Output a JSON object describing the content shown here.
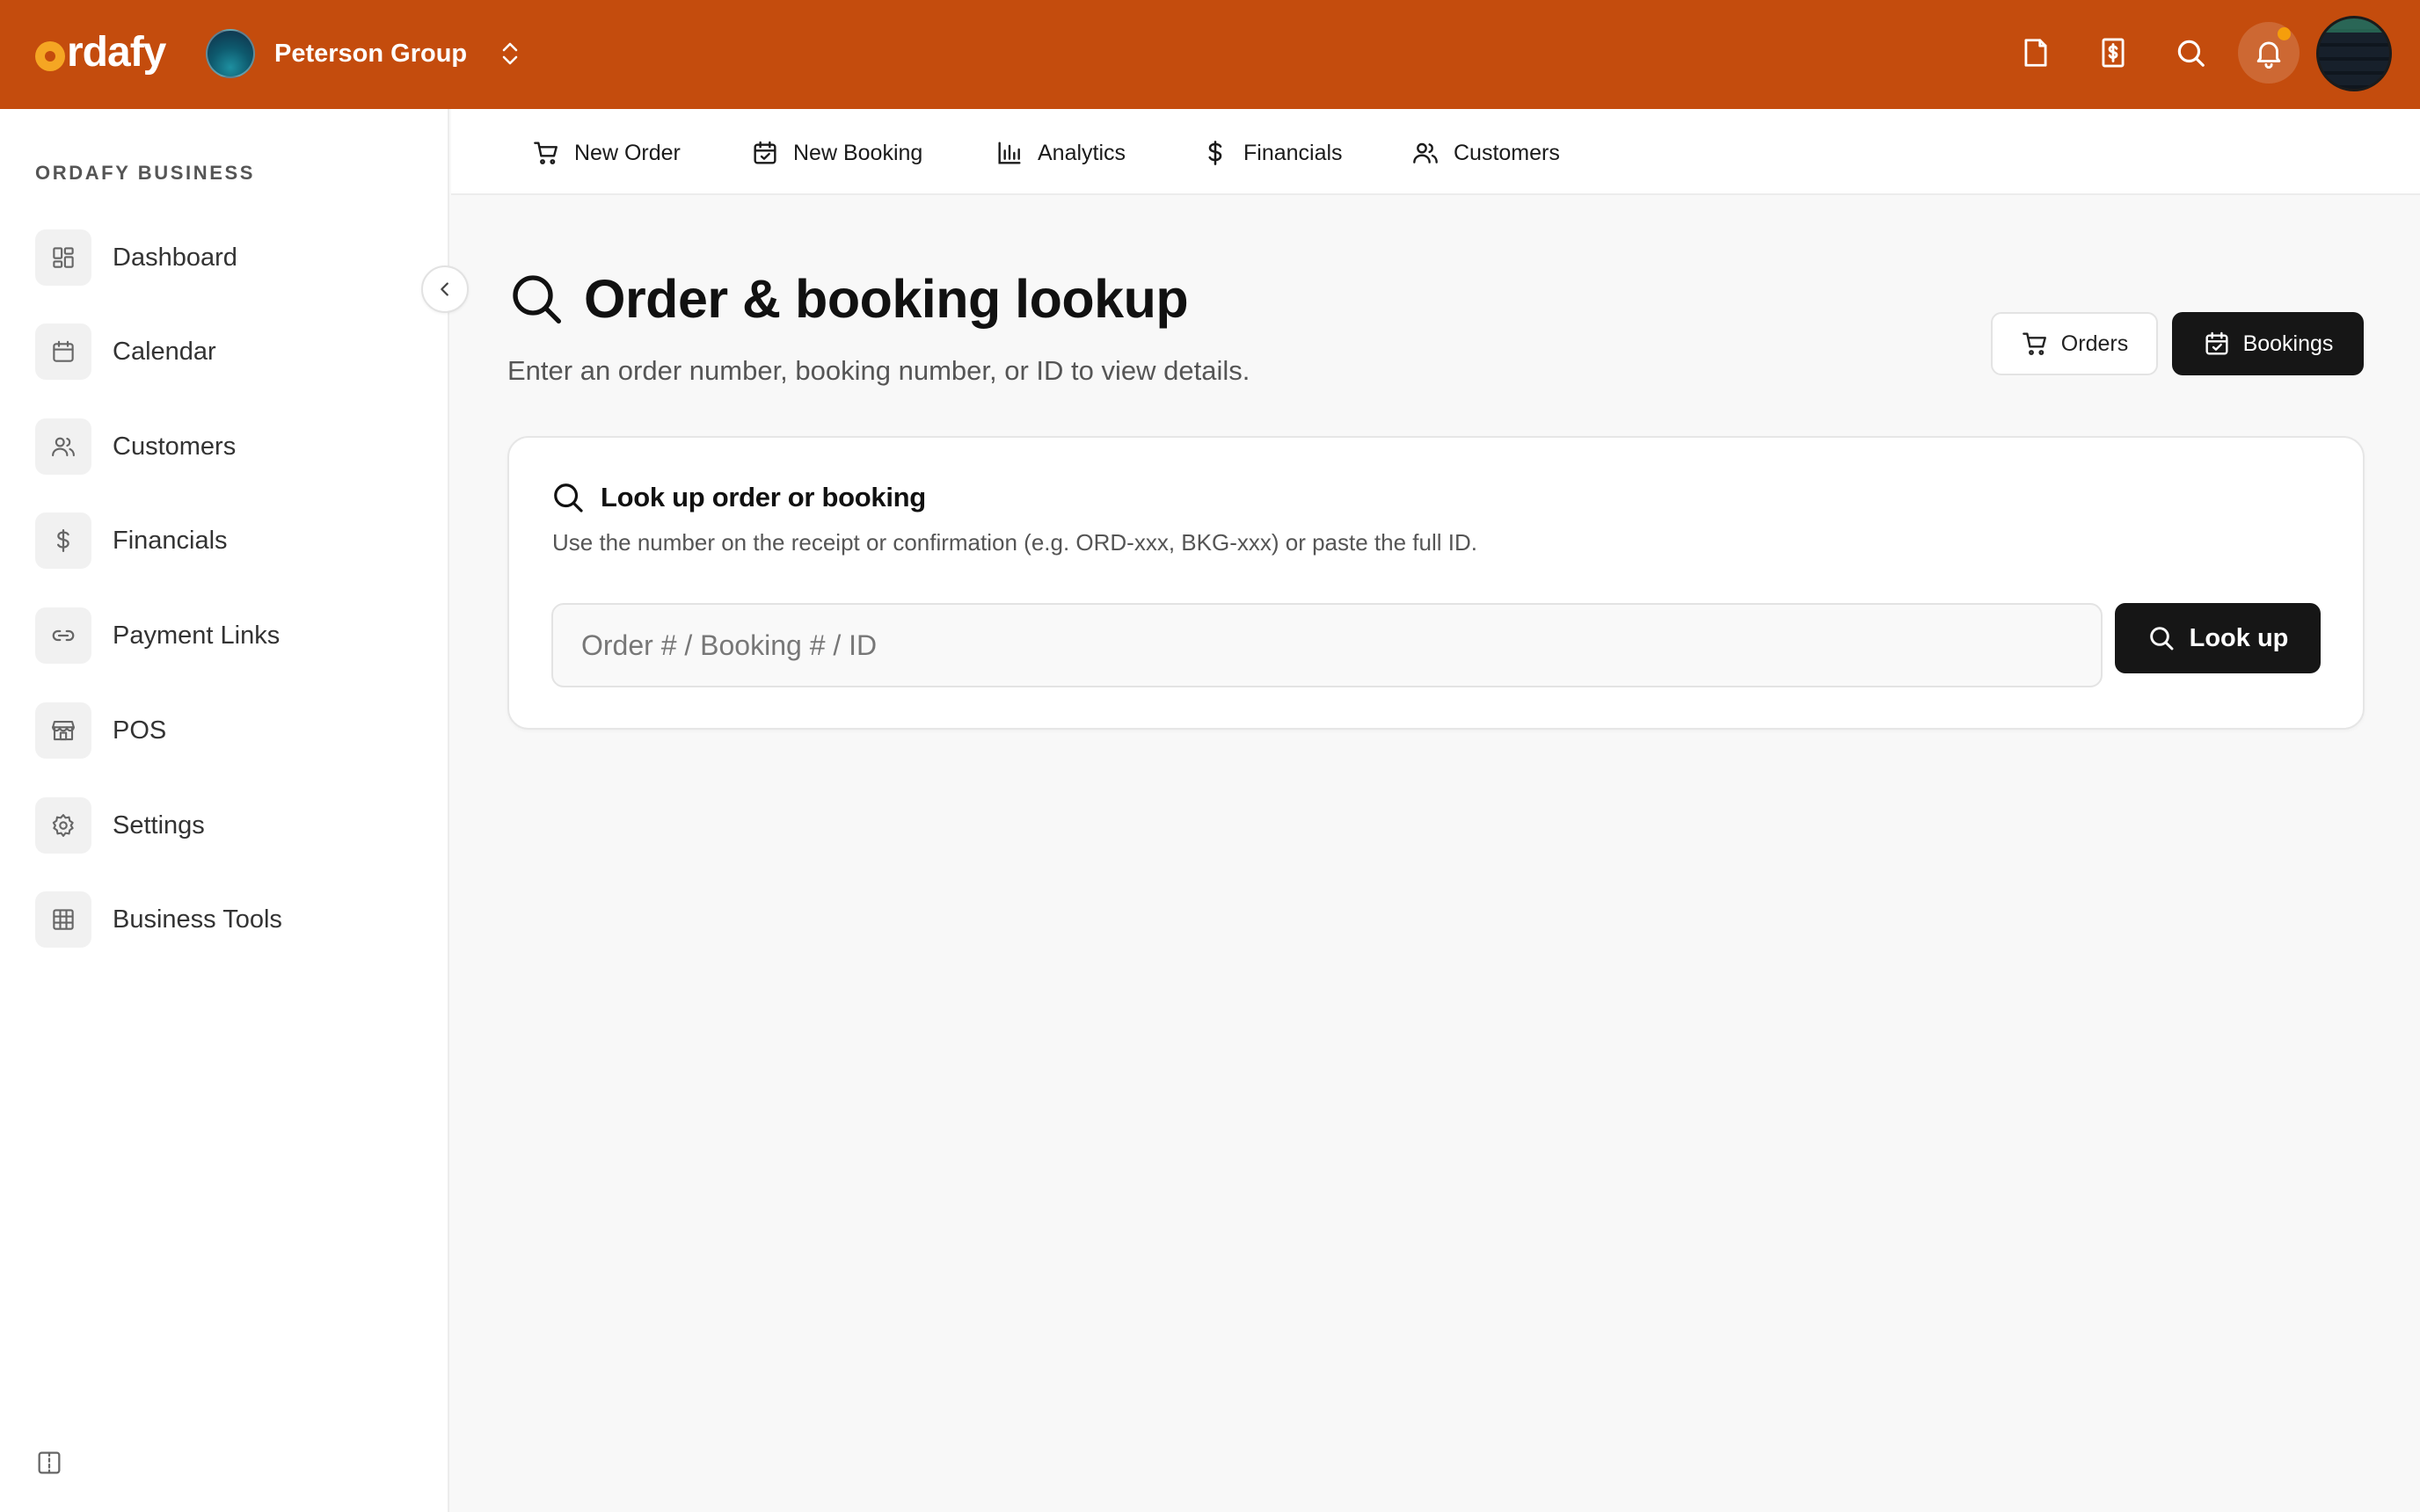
{
  "brand": {
    "name": "rdafy",
    "accent": "#c44c0d",
    "logo_accent": "#f5a623"
  },
  "header": {
    "org_name": "Peterson Group",
    "icons": [
      "document-icon",
      "receipt-dollar-icon",
      "search-icon",
      "bell-icon"
    ],
    "notification_badge_color": "#f59e0b"
  },
  "sidebar": {
    "heading": "ORDAFY BUSINESS",
    "items": [
      {
        "label": "Dashboard",
        "icon": "dashboard-icon"
      },
      {
        "label": "Calendar",
        "icon": "calendar-icon"
      },
      {
        "label": "Customers",
        "icon": "users-icon"
      },
      {
        "label": "Financials",
        "icon": "dollar-icon"
      },
      {
        "label": "Payment Links",
        "icon": "link-icon"
      },
      {
        "label": "POS",
        "icon": "store-icon"
      },
      {
        "label": "Settings",
        "icon": "gear-icon"
      },
      {
        "label": "Business Tools",
        "icon": "grid-icon"
      }
    ]
  },
  "subnav": {
    "items": [
      {
        "label": "New Order",
        "icon": "cart-icon"
      },
      {
        "label": "New Booking",
        "icon": "calendar-check-icon"
      },
      {
        "label": "Analytics",
        "icon": "bar-chart-icon"
      },
      {
        "label": "Financials",
        "icon": "dollar-icon"
      },
      {
        "label": "Customers",
        "icon": "users-icon"
      }
    ]
  },
  "main": {
    "title": "Order & booking lookup",
    "subtitle": "Enter an order number, booking number, or ID to view details.",
    "toggle": {
      "orders_label": "Orders",
      "bookings_label": "Bookings",
      "active": "Bookings"
    },
    "card": {
      "title": "Look up order or booking",
      "description": "Use the number on the receipt or confirmation (e.g. ORD-xxx, BKG-xxx) or paste the full ID.",
      "input_placeholder": "Order # / Booking # / ID",
      "input_value": "",
      "button_label": "Look up"
    }
  }
}
